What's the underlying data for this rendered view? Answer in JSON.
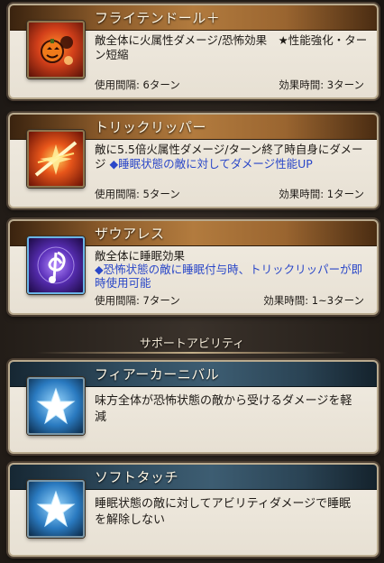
{
  "skills": [
    {
      "name": "フライテンドール＋",
      "desc": "敵全体に火属性ダメージ/恐怖効果　★性能強化・ターン短縮",
      "cooldown": "使用間隔: 6ターン",
      "duration": "効果時間: 3ターン",
      "icon": "pumpkin-doll-icon",
      "color": "#b4321a"
    },
    {
      "name": "トリックリッパー",
      "desc": "敵に5.5倍火属性ダメージ/ターン終了時自身にダメージ",
      "desc_highlight": "◆睡眠状態の敵に対してダメージ性能UP",
      "cooldown": "使用間隔: 5ターン",
      "duration": "効果時間: 1ターン",
      "icon": "slash-burst-icon",
      "color": "#c7361a"
    },
    {
      "name": "ザウアレス",
      "desc": "敵全体に睡眠効果",
      "desc_highlight": "◆恐怖状態の敵に睡眠付与時、トリックリッパーが即時使用可能",
      "cooldown": "使用間隔: 7ターン",
      "duration": "効果時間: 1~3ターン",
      "icon": "music-note-icon",
      "color": "#5b2fb0"
    }
  ],
  "section_title": "サポートアビリティ",
  "supports": [
    {
      "name": "フィアーカーニバル",
      "desc": "味方全体が恐怖状態の敵から受けるダメージを軽減",
      "icon": "star-icon"
    },
    {
      "name": "ソフトタッチ",
      "desc": "睡眠状態の敵に対してアビリティダメージで睡眠を解除しない",
      "icon": "star-icon"
    }
  ]
}
